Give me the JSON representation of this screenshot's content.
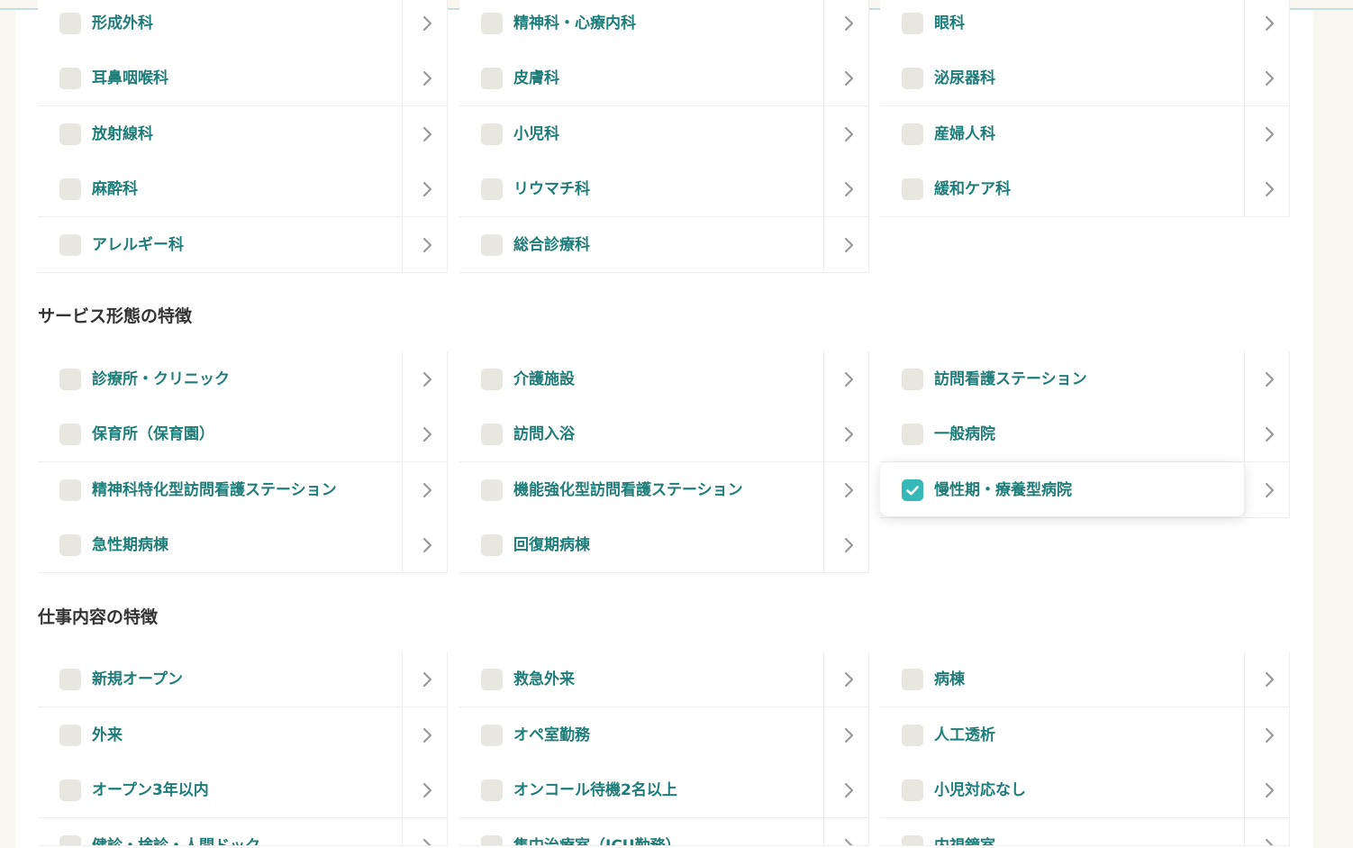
{
  "sections": [
    {
      "title": "",
      "items": [
        {
          "label": "形成外科",
          "checked": false
        },
        {
          "label": "精神科・心療内科",
          "checked": false
        },
        {
          "label": "眼科",
          "checked": false
        },
        {
          "label": "耳鼻咽喉科",
          "checked": false
        },
        {
          "label": "皮膚科",
          "checked": false
        },
        {
          "label": "泌尿器科",
          "checked": false
        },
        {
          "label": "放射線科",
          "checked": false
        },
        {
          "label": "小児科",
          "checked": false
        },
        {
          "label": "産婦人科",
          "checked": false
        },
        {
          "label": "麻酔科",
          "checked": false
        },
        {
          "label": "リウマチ科",
          "checked": false
        },
        {
          "label": "緩和ケア科",
          "checked": false
        },
        {
          "label": "アレルギー科",
          "checked": false
        },
        {
          "label": "総合診療科",
          "checked": false
        }
      ]
    },
    {
      "title": "サービス形態の特徴",
      "items": [
        {
          "label": "診療所・クリニック",
          "checked": false
        },
        {
          "label": "介護施設",
          "checked": false
        },
        {
          "label": "訪問看護ステーション",
          "checked": false
        },
        {
          "label": "保育所（保育園）",
          "checked": false
        },
        {
          "label": "訪問入浴",
          "checked": false
        },
        {
          "label": "一般病院",
          "checked": false
        },
        {
          "label": "精神科特化型訪問看護ステーション",
          "checked": false
        },
        {
          "label": "機能強化型訪問看護ステーション",
          "checked": false
        },
        {
          "label": "慢性期・療養型病院",
          "checked": true
        },
        {
          "label": "急性期病棟",
          "checked": false
        },
        {
          "label": "回復期病棟",
          "checked": false
        }
      ]
    },
    {
      "title": "仕事内容の特徴",
      "items": [
        {
          "label": "新規オープン",
          "checked": false
        },
        {
          "label": "救急外来",
          "checked": false
        },
        {
          "label": "病棟",
          "checked": false
        },
        {
          "label": "外来",
          "checked": false
        },
        {
          "label": "オペ室勤務",
          "checked": false
        },
        {
          "label": "人工透析",
          "checked": false
        },
        {
          "label": "オープン3年以内",
          "checked": false
        },
        {
          "label": "オンコール待機2名以上",
          "checked": false
        },
        {
          "label": "小児対応なし",
          "checked": false
        },
        {
          "label": "健診・検診・人間ドック",
          "checked": false
        },
        {
          "label": "集中治療室（ICU勤務）",
          "checked": false
        },
        {
          "label": "内視鏡室",
          "checked": false
        }
      ]
    }
  ],
  "colors": {
    "label": "#1f7d79",
    "heading": "#333333",
    "check_on": "#35b8b8",
    "check_off": "#e8e6e1",
    "chevron": "#999999"
  },
  "icons": {
    "checkbox": "checkbox-icon",
    "checked": "checkmark-icon",
    "row_arrow": "chevron-right-icon"
  }
}
